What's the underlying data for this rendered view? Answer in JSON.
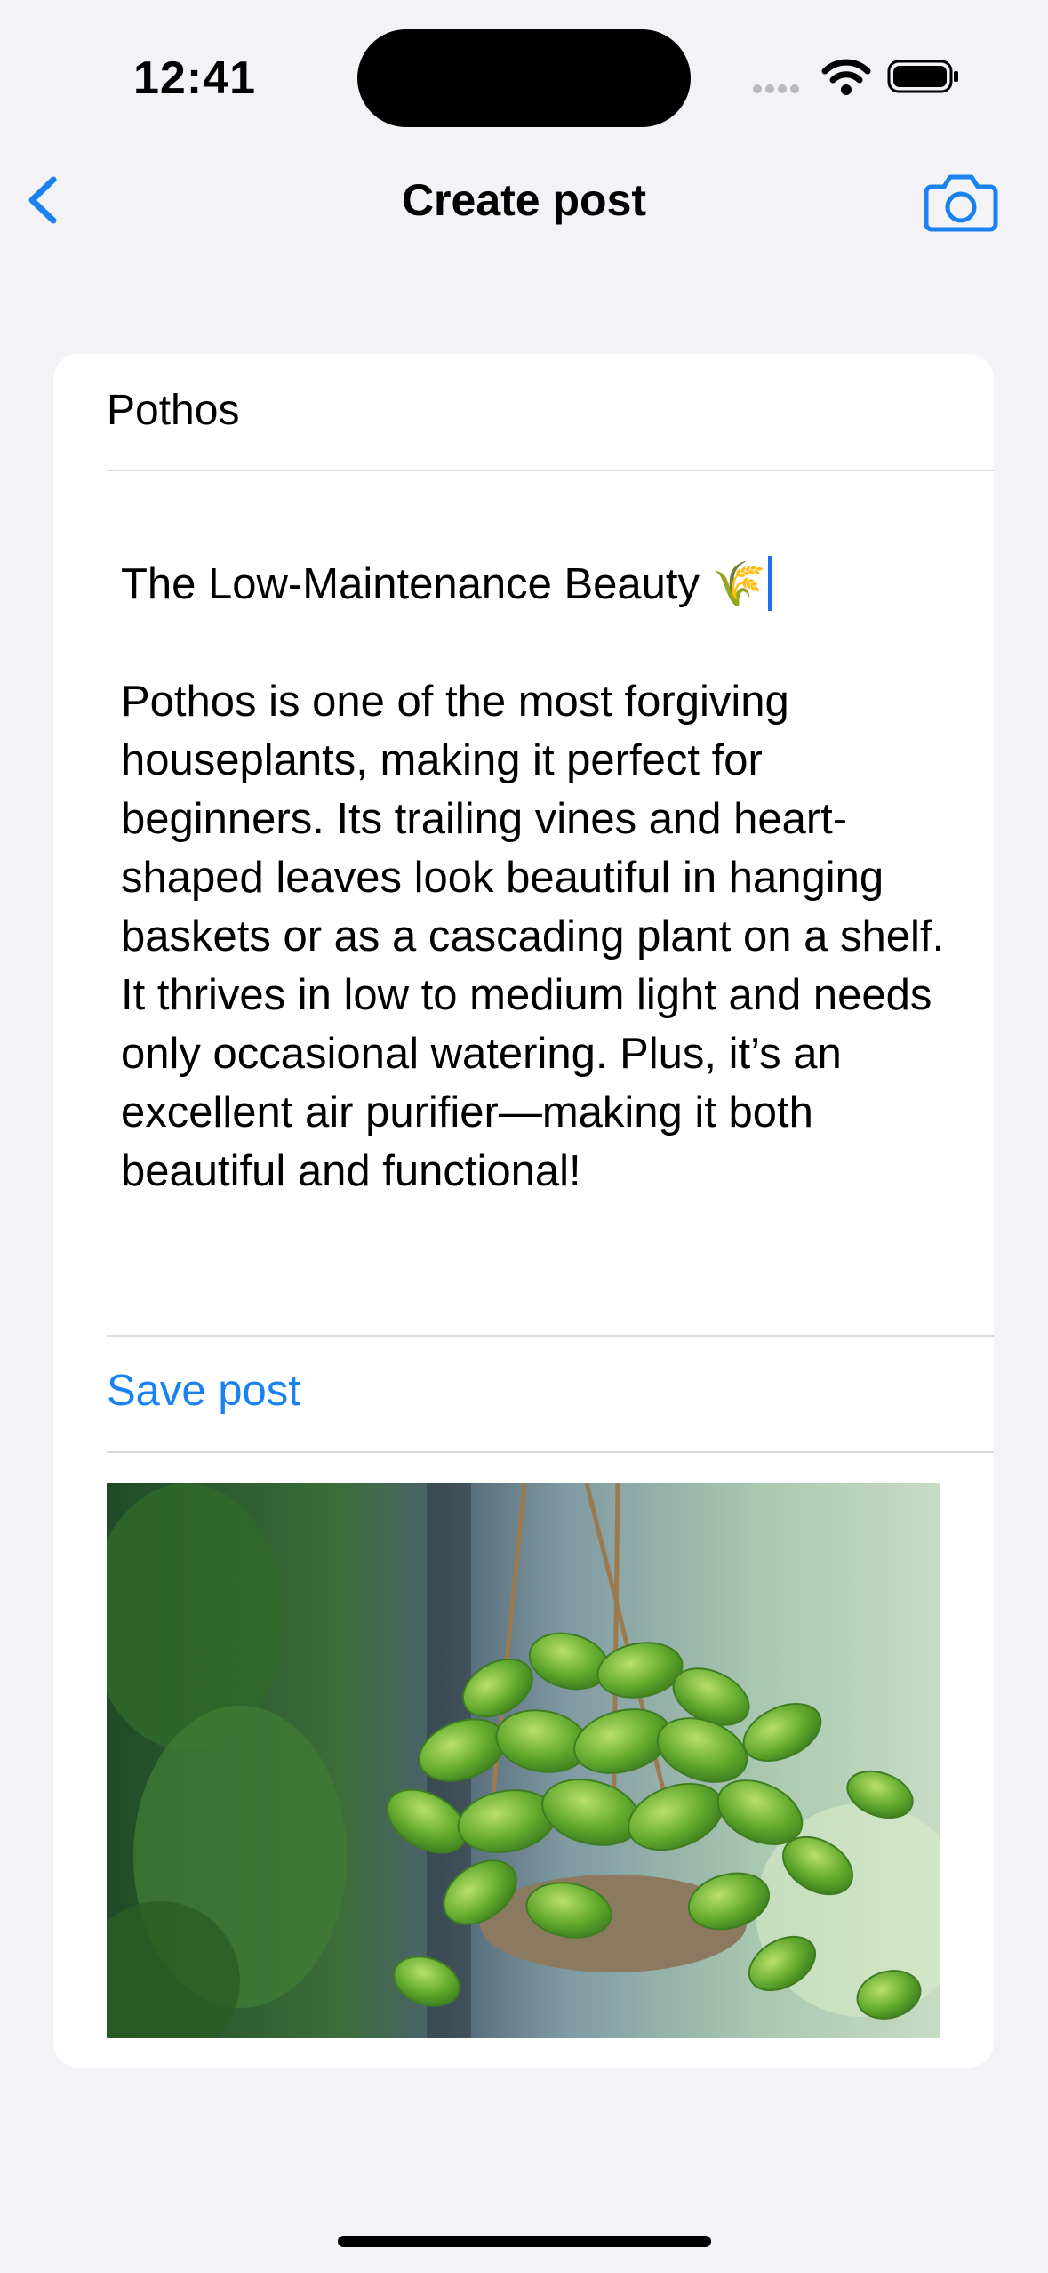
{
  "status_bar": {
    "time": "12:41"
  },
  "header": {
    "title": "Create post"
  },
  "card": {
    "field_title": "Pothos",
    "post_heading": "The Low-Maintenance Beauty 🌾",
    "post_text": "Pothos is one of the most forgiving houseplants, making it perfect for beginners. Its trailing vines and heart-shaped leaves look beautiful in hanging baskets or as a cascading plant on a shelf. It thrives in low to medium light and needs only occasional watering. Plus, it’s an excellent air purifier—making it both beautiful and functional!",
    "save_label": "Save post"
  },
  "colors": {
    "accent": "#1a82f0",
    "background": "#f2f2f7",
    "card": "#ffffff"
  },
  "icons": {
    "back": "chevron-left-icon",
    "camera": "camera-icon"
  }
}
